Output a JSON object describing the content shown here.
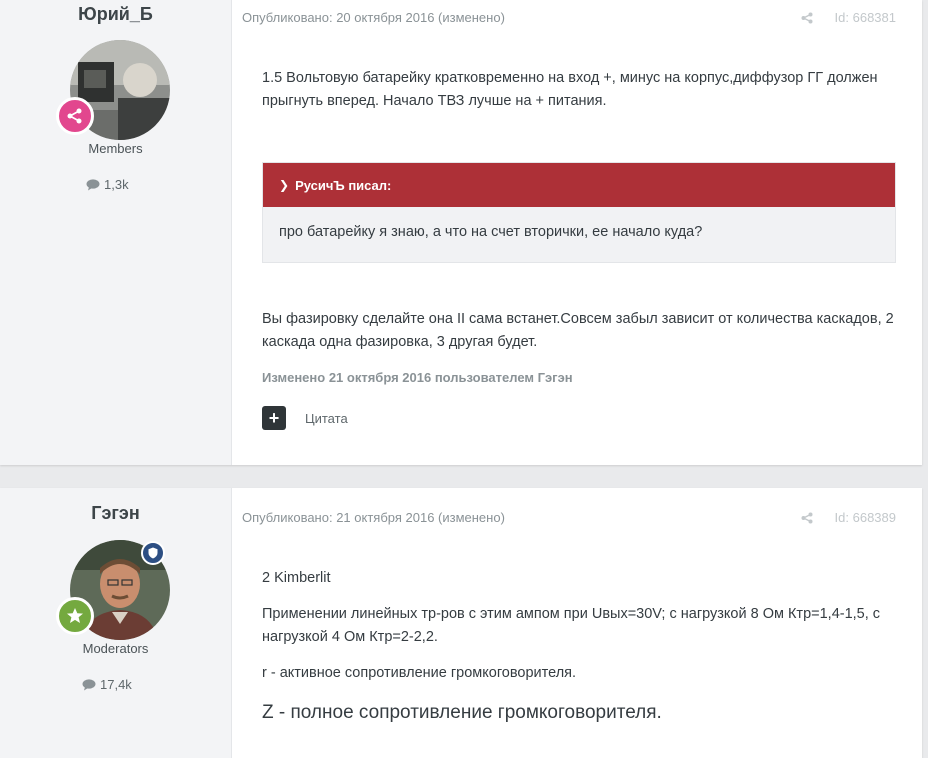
{
  "posts": [
    {
      "author": {
        "name": "Юрий_Б",
        "group": "Members",
        "reputation": "1,3k",
        "badge_color": "#e2478e"
      },
      "meta": {
        "published": "Опубликовано: 20 октября 2016 (изменено)",
        "id": "Id: 668381"
      },
      "paragraph1": "1.5 Вольтовую батарейку кратковременно на вход +, минус на корпус,диффузор ГГ должен прыгнуть вперед. Начало ТВЗ лучше на + питания.",
      "quote": {
        "author": "РусичЪ писал:",
        "text": "про батарейку я знаю, а что на счет вторички, ее начало куда?",
        "header_color": "#ad3037"
      },
      "paragraph2": "Вы фазировку сделайте она II сама встанет.Совсем забыл зависит от количества каскадов, 2 каскада одна фазировка, 3 другая будет.",
      "edited": "Изменено 21 октября 2016 пользователем Гэгэн",
      "quote_action": "Цитата"
    },
    {
      "author": {
        "name": "Гэгэн",
        "group": "Moderators",
        "reputation": "17,4k",
        "badge_color": "#74a93f"
      },
      "meta": {
        "published": "Опубликовано: 21 октября 2016 (изменено)",
        "id": "Id: 668389"
      },
      "lines": [
        "2 Kimberlit",
        "Применении линейных тр-ров с этим ампом при Uвых=30V; с нагрузкой 8 Ом Ктр=1,4-1,5, с нагрузкой 4 Ом Ктр=2-2,2.",
        "r - активное сопротивление громкоговорителя.",
        "Z - полное сопротивление громкоговорителя."
      ]
    }
  ]
}
